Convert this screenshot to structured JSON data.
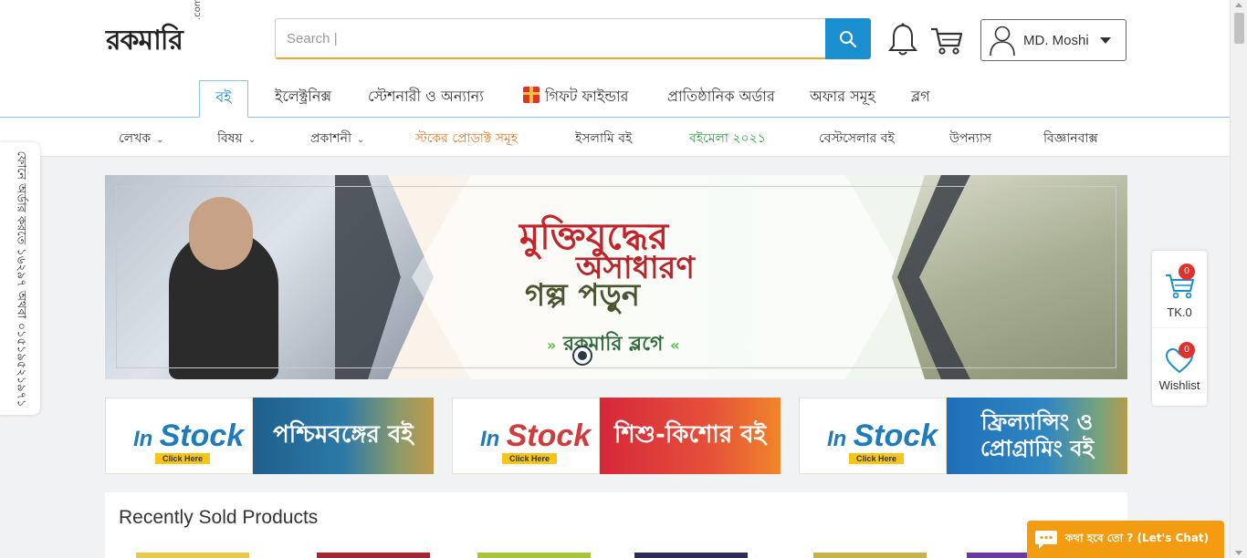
{
  "header": {
    "logo": {
      "text_main": "রকমারি",
      "text_suffix": ".com"
    },
    "search": {
      "placeholder": "Search |",
      "value": ""
    },
    "account": {
      "name": "MD. Moshi"
    }
  },
  "main_nav": {
    "items": [
      {
        "label": "বই",
        "active": true
      },
      {
        "label": "ইলেক্ট্রনিক্স"
      },
      {
        "label": "স্টেশনারী ও অন্যান্য"
      },
      {
        "label": "গিফট ফাইন্ডার"
      },
      {
        "label": "প্রাতিষ্ঠানিক অর্ডার"
      },
      {
        "label": "অফার সমূহ"
      },
      {
        "label": "ব্লগ"
      }
    ]
  },
  "sub_nav": {
    "items": [
      {
        "label": "লেখক",
        "dropdown": true
      },
      {
        "label": "বিষয়",
        "dropdown": true
      },
      {
        "label": "প্রকাশনী",
        "dropdown": true
      },
      {
        "label": "স্টকের প্রোডাক্ট সমূহ",
        "color": "#e87722"
      },
      {
        "label": "ইসলামি বই"
      },
      {
        "label": "বইমেলা ২০২১",
        "color": "#27a23a"
      },
      {
        "label": "বেস্টসেলার বই"
      },
      {
        "label": "উপন্যাস"
      },
      {
        "label": "বিজ্ঞানবাক্স"
      }
    ]
  },
  "hotline": {
    "text": "ফোনে অর্ডার করতে ১৬২৯৭ অথবা ০১৫১৯৫২১৯৭১"
  },
  "banner": {
    "line1": "মুক্তিযুদ্ধের",
    "line2": "অসাধারণ",
    "line3": "গল্প পড়ুন",
    "line4": "রকমারি ব্লগে"
  },
  "promos": [
    {
      "tag_in": "In",
      "tag_stock": "Stock",
      "click": "Click Here",
      "title": "পশ্চিমবঙ্গের বই"
    },
    {
      "tag_in": "In",
      "tag_stock": "Stock",
      "click": "Click Here",
      "title": "শিশু-কিশোর বই"
    },
    {
      "tag_in": "In",
      "tag_stock": "Stock",
      "click": "Click Here",
      "title_line1": "ফ্রিল্যান্সিং ও",
      "title_line2": "প্রোগ্রামিং বই"
    }
  ],
  "recent": {
    "title": "Recently Sold Products"
  },
  "widget": {
    "cart_count": "0",
    "cart_total": "TK.0",
    "wishlist_count": "0",
    "wishlist_label": "Wishlist"
  },
  "chat": {
    "label": "কথা হবে তো ? (Let's Chat)"
  },
  "colors": {
    "brand_blue": "#1a8ecf",
    "brand_red": "#e0322d",
    "accent_orange": "#f39c12",
    "accent_green": "#27a23a"
  }
}
